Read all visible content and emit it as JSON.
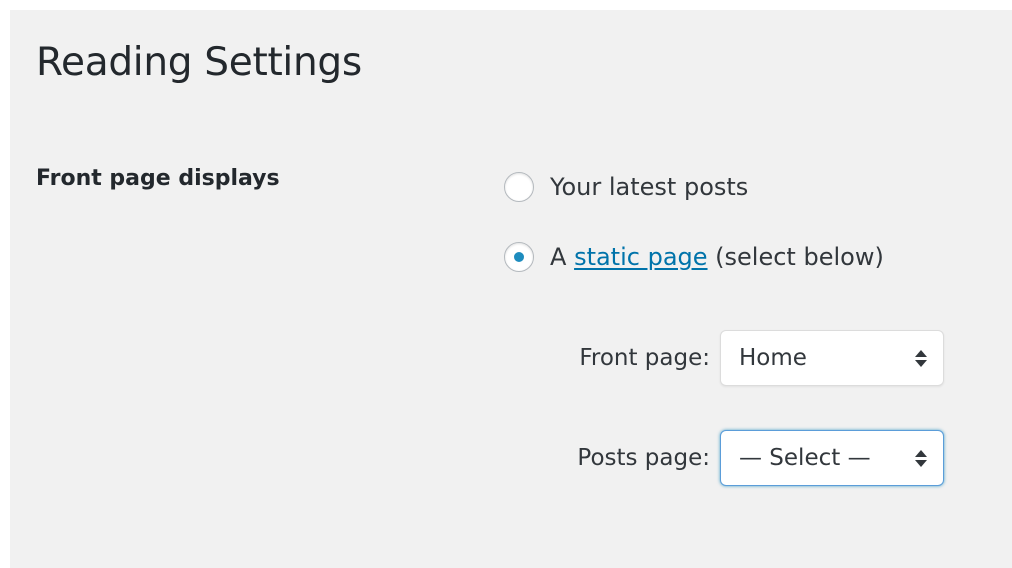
{
  "page": {
    "title": "Reading Settings"
  },
  "front_page_displays": {
    "label": "Front page displays",
    "options": [
      {
        "label": "Your latest posts",
        "selected": false
      },
      {
        "prefix": "A",
        "link_text": "static page",
        "suffix": "(select below)",
        "selected": true
      }
    ]
  },
  "front_page_select": {
    "label": "Front page:",
    "value": "Home"
  },
  "posts_page_select": {
    "label": "Posts page:",
    "value": "— Select —",
    "focused": true
  },
  "colors": {
    "accent": "#0073aa",
    "radio_dot": "#1e8cbe",
    "focus_border": "#5b9dd9",
    "background": "#f1f1f1"
  }
}
